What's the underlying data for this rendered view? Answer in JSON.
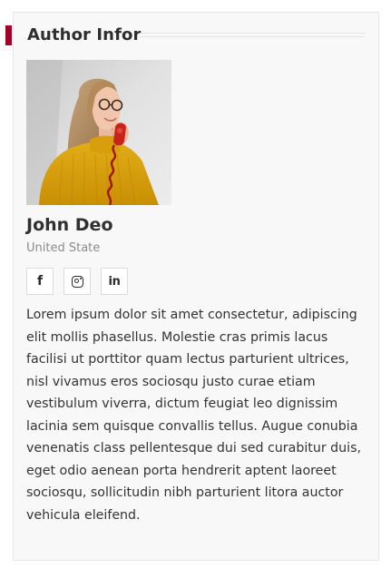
{
  "widget": {
    "title": "Author Infor",
    "accent_color": "#a3002b"
  },
  "author": {
    "name": "John Deo",
    "location": "United State",
    "photo_alt": "Author photo"
  },
  "social": {
    "facebook_icon": "facebook-icon",
    "instagram_icon": "instagram-icon",
    "linkedin_icon": "linkedin-icon",
    "facebook_glyph": "f",
    "linkedin_glyph": "in"
  },
  "bio": {
    "text": "Lorem ipsum dolor sit amet consectetur, adipiscing elit mollis phasellus. Molestie cras primis lacus facilisi ut porttitor quam lectus parturient ultrices, nisl vivamus eros sociosqu justo curae etiam vestibulum viverra, dictum feugiat leo dignissim lacinia sem quisque convallis tellus. Augue conubia venenatis class pellentesque dui sed curabitur duis, eget odio aenean porta hendrerit aptent laoreet sociosqu, sollicitudin nibh parturient litora auctor vehicula eleifend."
  }
}
